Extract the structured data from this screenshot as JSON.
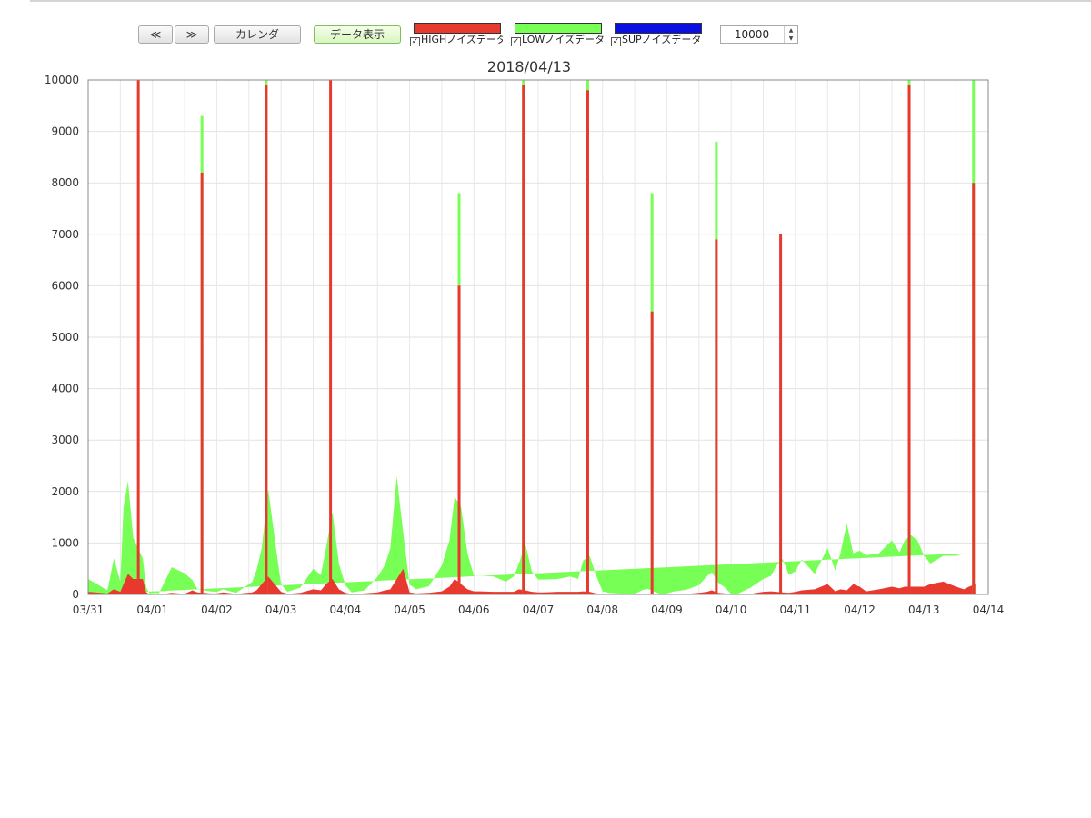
{
  "toolbar": {
    "prev_label": "≪",
    "next_label": "≫",
    "calendar_label": "カレンダ",
    "show_data_label": "データ表示",
    "max_value": "10000"
  },
  "legend": [
    {
      "label": "HIGHノイズデータ",
      "color": "#e8392f",
      "checked": true
    },
    {
      "label": "LOWノイズデータ",
      "color": "#77ff55",
      "checked": true
    },
    {
      "label": "SUPノイズデータ",
      "color": "#0a10e0",
      "checked": true
    }
  ],
  "chart_data": {
    "type": "area",
    "title": "2018/04/13",
    "xlabel": "",
    "ylabel": "",
    "ylim": [
      0,
      10000
    ],
    "yticks": [
      0,
      1000,
      2000,
      3000,
      4000,
      5000,
      6000,
      7000,
      8000,
      9000,
      10000
    ],
    "x_ticks": [
      "03/31",
      "04/01",
      "04/02",
      "04/03",
      "04/04",
      "04/05",
      "04/06",
      "04/07",
      "04/08",
      "04/09",
      "04/10",
      "04/11",
      "04/12",
      "04/13",
      "04/14"
    ],
    "grid": true,
    "stacked": true,
    "series": [
      {
        "name": "HIGHノイズデータ",
        "color": "#e8392f"
      },
      {
        "name": "LOWノイズデータ",
        "color": "#77ff55"
      },
      {
        "name": "SUPノイズデータ",
        "color": "#0a10e0"
      }
    ],
    "x_days": [
      0.0,
      0.3,
      0.4,
      0.5,
      0.55,
      0.62,
      0.7,
      0.85,
      0.9,
      0.95,
      1.05,
      1.1,
      1.3,
      1.5,
      1.62,
      1.7,
      1.8,
      1.9,
      2.0,
      2.1,
      2.3,
      2.55,
      2.62,
      2.7,
      2.8,
      2.9,
      3.0,
      3.1,
      3.3,
      3.5,
      3.62,
      3.7,
      3.8,
      3.9,
      4.0,
      4.1,
      4.3,
      4.5,
      4.62,
      4.7,
      4.8,
      4.9,
      5.0,
      5.1,
      5.3,
      5.5,
      5.62,
      5.7,
      5.8,
      5.9,
      6.0,
      6.1,
      6.3,
      6.5,
      6.62,
      6.7,
      6.8,
      6.9,
      7.0,
      7.1,
      7.3,
      7.5,
      7.62,
      7.7,
      7.8,
      7.9,
      8.0,
      8.1,
      8.3,
      8.5,
      8.62,
      8.7,
      8.8,
      8.9,
      9.0,
      9.1,
      9.3,
      9.5,
      9.62,
      9.7,
      9.8,
      9.9,
      10.0,
      10.1,
      10.3,
      10.5,
      10.62,
      10.7,
      10.8,
      10.9,
      11.0,
      11.1,
      11.3,
      11.5,
      11.62,
      11.7,
      11.8,
      11.9,
      12.0,
      12.1,
      12.3,
      12.5,
      12.62,
      12.7,
      12.8,
      12.9,
      13.0,
      13.1,
      13.3,
      13.5,
      13.62,
      13.7,
      13.8
    ],
    "high_values": [
      50,
      20,
      100,
      50,
      200,
      400,
      300,
      300,
      50,
      0,
      0,
      0,
      30,
      10,
      80,
      40,
      30,
      20,
      20,
      40,
      10,
      40,
      80,
      200,
      350,
      200,
      50,
      10,
      30,
      100,
      80,
      200,
      300,
      100,
      30,
      10,
      20,
      40,
      80,
      100,
      300,
      500,
      40,
      20,
      30,
      60,
      150,
      300,
      200,
      100,
      60,
      60,
      50,
      50,
      50,
      100,
      80,
      50,
      40,
      40,
      50,
      50,
      50,
      60,
      50,
      20,
      10,
      10,
      5,
      0,
      5,
      10,
      5,
      0,
      0,
      5,
      10,
      30,
      50,
      80,
      30,
      20,
      0,
      0,
      10,
      50,
      60,
      50,
      40,
      30,
      50,
      80,
      100,
      200,
      60,
      100,
      80,
      200,
      150,
      60,
      100,
      150,
      120,
      150,
      150,
      150,
      150,
      200,
      250,
      150,
      100,
      150,
      200
    ],
    "low_values": [
      250,
      60,
      600,
      200,
      1500,
      1800,
      800,
      400,
      100,
      20,
      30,
      20,
      500,
      400,
      200,
      60,
      50,
      40,
      30,
      60,
      20,
      200,
      400,
      700,
      1700,
      900,
      150,
      40,
      100,
      400,
      300,
      700,
      1300,
      500,
      150,
      30,
      60,
      300,
      500,
      800,
      2000,
      700,
      150,
      80,
      130,
      500,
      900,
      1600,
      1500,
      700,
      300,
      300,
      300,
      200,
      300,
      500,
      900,
      400,
      250,
      250,
      250,
      300,
      250,
      600,
      700,
      350,
      50,
      20,
      10,
      10,
      80,
      100,
      50,
      10,
      20,
      50,
      80,
      150,
      300,
      350,
      200,
      120,
      10,
      10,
      120,
      250,
      300,
      500,
      650,
      350,
      400,
      600,
      300,
      700,
      400,
      700,
      1300,
      600,
      700,
      700,
      700,
      900,
      700,
      900,
      1000,
      900,
      600,
      400,
      500,
      600,
      700
    ],
    "spikes": [
      {
        "day": 0.78,
        "high": 10000,
        "low": 0
      },
      {
        "day": 1.77,
        "high": 8200,
        "low": 1100
      },
      {
        "day": 2.77,
        "high": 9900,
        "low": 100
      },
      {
        "day": 3.77,
        "high": 10000,
        "low": 0
      },
      {
        "day": 5.77,
        "high": 6000,
        "low": 1800
      },
      {
        "day": 6.77,
        "high": 9900,
        "low": 100
      },
      {
        "day": 7.77,
        "high": 9800,
        "low": 200
      },
      {
        "day": 8.77,
        "high": 5500,
        "low": 2300
      },
      {
        "day": 9.77,
        "high": 6900,
        "low": 1900
      },
      {
        "day": 10.77,
        "high": 7000,
        "low": 0
      },
      {
        "day": 12.77,
        "high": 9900,
        "low": 100
      },
      {
        "day": 13.77,
        "high": 8000,
        "low": 2000
      }
    ]
  }
}
